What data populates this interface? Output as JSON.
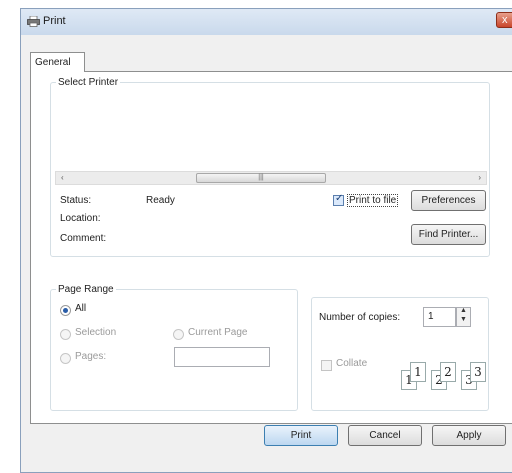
{
  "window": {
    "title": "Print",
    "close_glyph": "x"
  },
  "tabs": [
    {
      "label": "General"
    }
  ],
  "select_printer": {
    "legend": "Select Printer",
    "status_label": "Status:",
    "status_value": "Ready",
    "location_label": "Location:",
    "comment_label": "Comment:",
    "print_to_file_label": "Print to file",
    "print_to_file_checked": true,
    "preferences_label": "Preferences",
    "find_printer_label": "Find Printer...",
    "scroll_left": "‹",
    "scroll_right": "›",
    "thumb_grip": "|||"
  },
  "page_range": {
    "legend": "Page Range",
    "options": {
      "all": "All",
      "selection": "Selection",
      "current_page": "Current Page",
      "pages": "Pages:"
    },
    "selected": "all",
    "pages_value": ""
  },
  "copies": {
    "label": "Number of copies:",
    "value": "1",
    "collate_label": "Collate",
    "collate_checked": false,
    "collate_icons": [
      "1",
      "1",
      "2",
      "2",
      "3",
      "3"
    ]
  },
  "footer": {
    "print_label": "Print",
    "cancel_label": "Cancel",
    "apply_label": "Apply"
  },
  "colors": {
    "title_bar": "#c9d9ec",
    "close_button": "#c9452b",
    "accent": "#2a5da8"
  },
  "icons": {
    "title": "printer-icon",
    "close": "close-icon",
    "spin_up": "spin-up-icon",
    "spin_down": "spin-down-icon"
  }
}
